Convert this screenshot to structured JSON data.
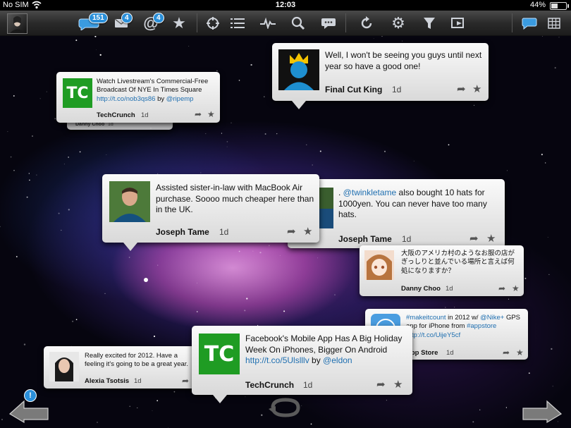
{
  "status_bar": {
    "carrier": "No SIM",
    "time": "12:03",
    "battery": "44%",
    "battery_level": 0.44
  },
  "toolbar": {
    "badges": {
      "timeline": "151",
      "messages": "4",
      "mentions": "4"
    },
    "icons": [
      "timeline-icon",
      "messages-icon",
      "mentions-icon",
      "favorites-icon",
      "target-icon",
      "lists-icon",
      "activity-icon",
      "search-icon",
      "conversations-icon",
      "refresh-icon",
      "settings-icon",
      "filter-icon",
      "compose-icon",
      "bubble-view-icon",
      "grid-view-icon"
    ]
  },
  "tweets": [
    {
      "id": "final-cut-king",
      "text": "Well, I won't be seeing you guys until next year so have a good one!",
      "name": "Final Cut King",
      "ago": "1d"
    },
    {
      "id": "techcrunch-livestream",
      "text_parts": [
        "Watch Livestream's Commercial-Free Broadcast Of NYE In Times Square ",
        "http://t.co/nob3qs86",
        " by ",
        "@ripemp"
      ],
      "name": "TechCrunch",
      "ago": "1d",
      "logo": "TC"
    },
    {
      "id": "danny-choo-behind",
      "name": "Danny Choo",
      "ago": "1d"
    },
    {
      "id": "joseph-tame-1",
      "text": "Assisted sister-in-law with MacBook Air purchase. Soooo much cheaper here than in the UK.",
      "name": "Joseph Tame",
      "ago": "1d"
    },
    {
      "id": "joseph-tame-2",
      "text_parts": [
        ". ",
        "@twinkletame",
        " also bought 10 hats for 1000yen. You can never have too many hats."
      ],
      "name": "Joseph Tame",
      "ago": "1d"
    },
    {
      "id": "danny-choo",
      "text": "大阪のアメリカ村のようなお服の店が ぎっしりと並んでいる場所と言えば何処になりますか？",
      "name": "Danny Choo",
      "ago": "1d"
    },
    {
      "id": "app-store",
      "text_parts": [
        "#makeitcount",
        " in 2012 w/ ",
        "@Nike+",
        " GPS app for iPhone from ",
        "#appstore",
        " ",
        "http://t.co/UijeY5cf"
      ],
      "name": "App Store",
      "ago": "1d"
    },
    {
      "id": "alexia-tsotsis",
      "text": "Really excited for 2012. Have a feeling it's going to be a great year.",
      "name": "Alexia Tsotsis",
      "ago": "1d"
    },
    {
      "id": "techcrunch-facebook",
      "text_parts": [
        "Facebook's Mobile App Has A Big Holiday Week On iPhones, Bigger On Android ",
        "http://t.co/5Ulslllv",
        " by ",
        "@eldon"
      ],
      "name": "TechCrunch",
      "ago": "1d",
      "logo": "TC"
    }
  ],
  "bottom": {
    "alert_badge": "!"
  },
  "colors": {
    "accent": "#2a8fd9",
    "link": "#1f6fb0",
    "techcrunch_green": "#1f9c23"
  }
}
